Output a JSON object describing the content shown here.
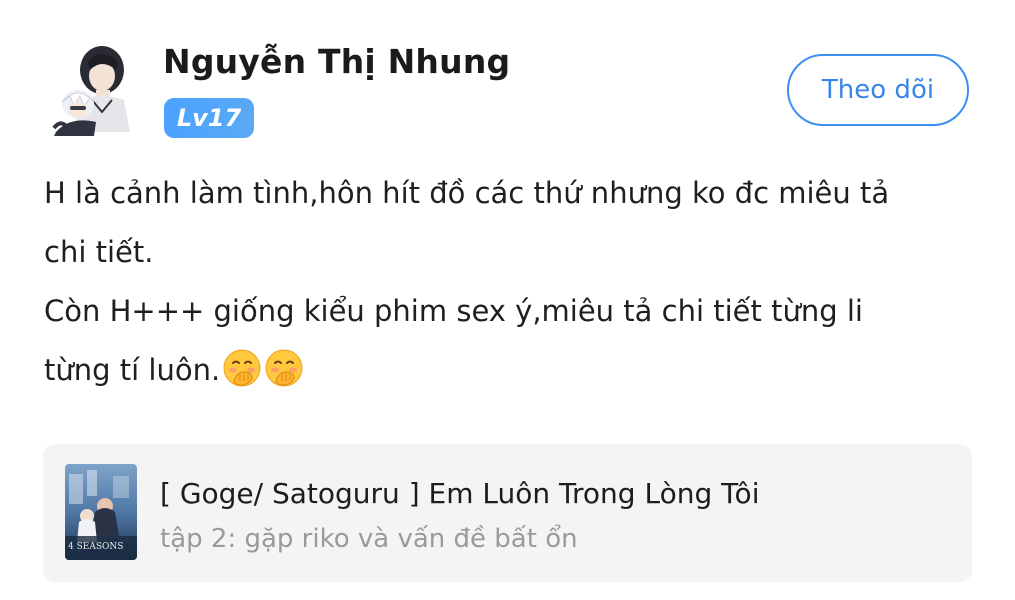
{
  "user": {
    "name": "Nguyễn Thị Nhung",
    "level": "Lv17",
    "avatar_icon": "anime-character-avatar-icon"
  },
  "actions": {
    "follow_label": "Theo dõi"
  },
  "post": {
    "lines": [
      "H là cảnh làm tình,hôn hít đồ các thứ nhưng ko đc miêu tả",
      "chi tiết.",
      "Còn H+++ giống kiểu phim sex ý,miêu tả chi tiết từng li",
      "từng tí luôn."
    ],
    "emojis": [
      "face-with-hand-over-mouth-emoji",
      "face-with-hand-over-mouth-emoji"
    ]
  },
  "book": {
    "title": "[ Goge/ Satoguru ] Em Luôn Trong Lòng Tôi",
    "chapter": "tập 2: gặp riko và vấn đề bất ổn",
    "cover_text": "4 SEASONS"
  },
  "colors": {
    "accent": "#3d8ff2",
    "level_badge": "#4ba3ff",
    "card_bg": "#f4f4f5",
    "subtitle": "#9a9a9e"
  }
}
